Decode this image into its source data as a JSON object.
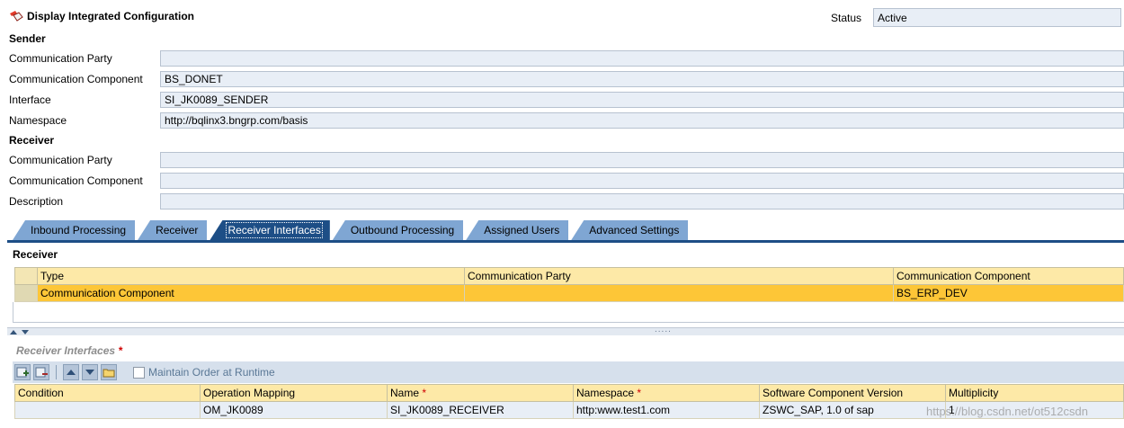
{
  "header": {
    "title": "Display Integrated Configuration",
    "status_label": "Status",
    "status_value": "Active"
  },
  "sender": {
    "heading": "Sender",
    "fields": [
      {
        "label": "Communication Party",
        "value": ""
      },
      {
        "label": "Communication Component",
        "value": "BS_DONET"
      },
      {
        "label": "Interface",
        "value": "SI_JK0089_SENDER"
      },
      {
        "label": "Namespace",
        "value": "http://bqlinx3.bngrp.com/basis"
      }
    ]
  },
  "receiver": {
    "heading": "Receiver",
    "fields": [
      {
        "label": "Communication Party",
        "value": ""
      },
      {
        "label": "Communication Component",
        "value": ""
      },
      {
        "label": "Description",
        "value": ""
      }
    ]
  },
  "tabs": [
    {
      "label": "Inbound Processing",
      "active": false
    },
    {
      "label": "Receiver",
      "active": false
    },
    {
      "label": "Receiver Interfaces",
      "active": true
    },
    {
      "label": "Outbound Processing",
      "active": false
    },
    {
      "label": "Assigned Users",
      "active": false
    },
    {
      "label": "Advanced Settings",
      "active": false
    }
  ],
  "receiver_table": {
    "heading": "Receiver",
    "columns": [
      "Type",
      "Communication Party",
      "Communication Component"
    ],
    "rows": [
      [
        "Communication Component",
        "",
        "BS_ERP_DEV"
      ]
    ]
  },
  "receiver_interfaces": {
    "heading": "Receiver Interfaces",
    "required_mark": "*",
    "maintain_order_label": "Maintain Order at Runtime",
    "columns": [
      "Condition",
      "Operation Mapping",
      "Name",
      "Namespace",
      "Software Component Version",
      "Multiplicity"
    ],
    "rows": [
      [
        "",
        "OM_JK0089",
        "SI_JK0089_RECEIVER",
        "http:www.test1.com",
        "ZSWC_SAP, 1.0 of sap",
        "1"
      ]
    ]
  },
  "watermark": "https://blog.csdn.net/ot512csdn",
  "colors": {
    "tab": "#7fa6d3",
    "tab_active": "#1d4e86",
    "grid_header": "#fde9a7",
    "selected_row": "#fdc637",
    "field_bg": "#e8eef6"
  }
}
